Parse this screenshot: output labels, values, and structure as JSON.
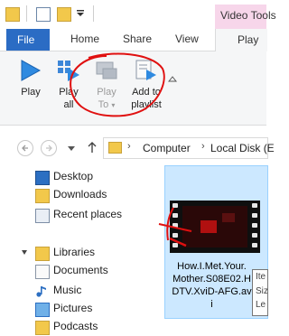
{
  "contextual_tab": {
    "label": "Video Tools",
    "color": "#f7d6ea"
  },
  "tabs": {
    "file": "File",
    "home": "Home",
    "share": "Share",
    "view": "View",
    "play": "Play"
  },
  "ribbon": {
    "play": "Play",
    "play_all_1": "Play",
    "play_all_2": "all",
    "play_to_1": "Play",
    "play_to_2": "To",
    "add_to_playlist_1": "Add to",
    "add_to_playlist_2": "playlist"
  },
  "address": {
    "segments": [
      "Computer",
      "Local Disk (E"
    ]
  },
  "nav_pane": {
    "favorites": [
      "Desktop",
      "Downloads",
      "Recent places"
    ],
    "libraries_label": "Libraries",
    "libraries": [
      "Documents",
      "Music",
      "Pictures",
      "Podcasts"
    ]
  },
  "file": {
    "name_lines": [
      "How.I.Met.Your.",
      "Mother.S08E02.H",
      "DTV.XviD-AFG.av",
      "i"
    ]
  },
  "tooltip": {
    "lines": [
      "Ite",
      "Siz",
      "Le"
    ]
  },
  "colors": {
    "file_tab": "#2b6cc4",
    "selection": "#cce8ff",
    "annotation": "#e01010"
  }
}
